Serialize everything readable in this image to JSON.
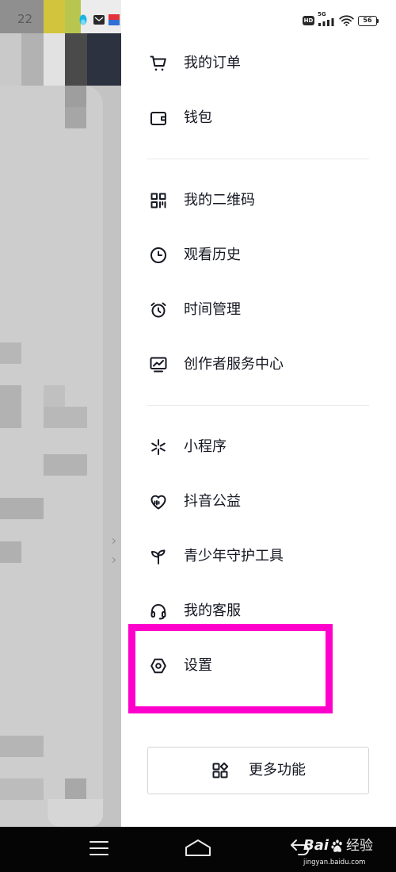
{
  "status_bar": {
    "time": "22",
    "hd_badge": "HD",
    "network_type": "5G",
    "battery_level": "56",
    "left_icons": [
      "qq-icon",
      "mail-icon",
      "app-notification-icon"
    ],
    "right_icons": [
      "signal-icon",
      "wifi-icon",
      "battery-icon"
    ]
  },
  "drawer": {
    "groups": [
      {
        "items": [
          {
            "label": "我的订单",
            "icon": "cart-icon"
          },
          {
            "label": "钱包",
            "icon": "wallet-icon"
          }
        ]
      },
      {
        "items": [
          {
            "label": "我的二维码",
            "icon": "qr-code-icon"
          },
          {
            "label": "观看历史",
            "icon": "clock-icon"
          },
          {
            "label": "时间管理",
            "icon": "alarm-clock-icon"
          },
          {
            "label": "创作者服务中心",
            "icon": "creator-chart-icon"
          }
        ]
      },
      {
        "items": [
          {
            "label": "小程序",
            "icon": "mini-program-icon"
          },
          {
            "label": "抖音公益",
            "icon": "charity-heart-icon"
          },
          {
            "label": "青少年守护工具",
            "icon": "sprout-icon"
          },
          {
            "label": "我的客服",
            "icon": "headset-icon"
          },
          {
            "label": "设置",
            "icon": "settings-icon"
          }
        ]
      }
    ],
    "more_button": {
      "label": "更多功能",
      "icon": "more-grid-icon"
    }
  },
  "annotation": {
    "highlight_color": "#ff00cc"
  },
  "nav_bar": {
    "icons": [
      "menu-icon",
      "home-icon",
      "back-icon"
    ]
  },
  "watermark": {
    "brand_left": "Bai",
    "brand_right": "经验",
    "url": "jingyan.baidu.com"
  },
  "colors": {
    "drawer_background": "#ffffff",
    "text": "#161823",
    "divider": "#ebebeb",
    "nav_bar": "#050505",
    "overlay": "#c3c3c3"
  }
}
